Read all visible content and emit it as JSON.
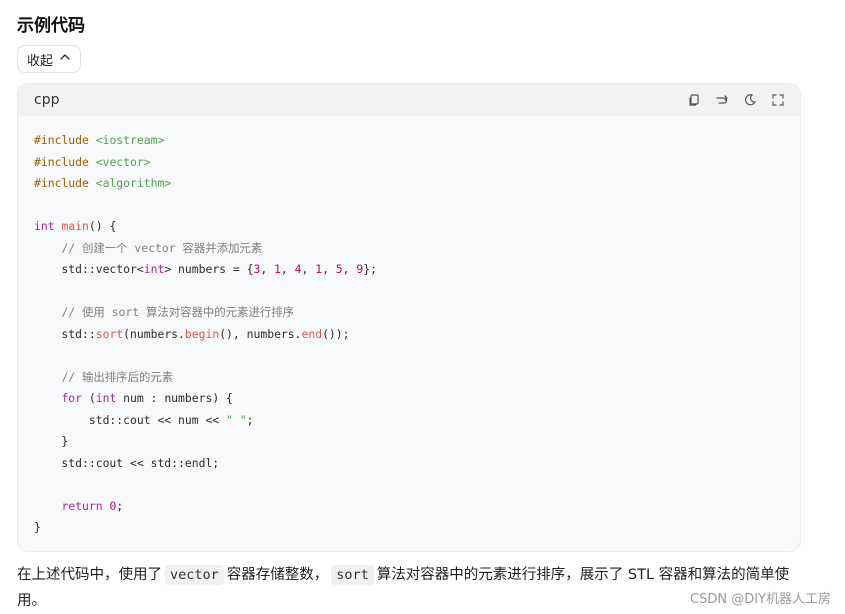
{
  "heading": "示例代码",
  "collapse_label": "收起",
  "code_block": {
    "language": "cpp",
    "lines": [
      [
        {
          "t": "#include",
          "c": "pp"
        },
        {
          "t": " "
        },
        {
          "t": "<iostream>",
          "c": "inc"
        }
      ],
      [
        {
          "t": "#include",
          "c": "pp"
        },
        {
          "t": " "
        },
        {
          "t": "<vector>",
          "c": "inc"
        }
      ],
      [
        {
          "t": "#include",
          "c": "pp"
        },
        {
          "t": " "
        },
        {
          "t": "<algorithm>",
          "c": "inc"
        }
      ],
      [],
      [
        {
          "t": "int",
          "c": "ty"
        },
        {
          "t": " "
        },
        {
          "t": "main",
          "c": "fn"
        },
        {
          "t": "() {"
        }
      ],
      [
        {
          "t": "    "
        },
        {
          "t": "// 创建一个 vector 容器并添加元素",
          "c": "cm"
        }
      ],
      [
        {
          "t": "    std::vector<"
        },
        {
          "t": "int",
          "c": "ty"
        },
        {
          "t": "> numbers = {"
        },
        {
          "t": "3",
          "c": "num"
        },
        {
          "t": ", "
        },
        {
          "t": "1",
          "c": "num"
        },
        {
          "t": ", "
        },
        {
          "t": "4",
          "c": "num"
        },
        {
          "t": ", "
        },
        {
          "t": "1",
          "c": "num"
        },
        {
          "t": ", "
        },
        {
          "t": "5",
          "c": "num"
        },
        {
          "t": ", "
        },
        {
          "t": "9",
          "c": "num"
        },
        {
          "t": "};"
        }
      ],
      [],
      [
        {
          "t": "    "
        },
        {
          "t": "// 使用 sort 算法对容器中的元素进行排序",
          "c": "cm"
        }
      ],
      [
        {
          "t": "    std::"
        },
        {
          "t": "sort",
          "c": "fn"
        },
        {
          "t": "(numbers."
        },
        {
          "t": "begin",
          "c": "fn"
        },
        {
          "t": "(), numbers."
        },
        {
          "t": "end",
          "c": "fn"
        },
        {
          "t": "());"
        }
      ],
      [],
      [
        {
          "t": "    "
        },
        {
          "t": "// 输出排序后的元素",
          "c": "cm"
        }
      ],
      [
        {
          "t": "    "
        },
        {
          "t": "for",
          "c": "kw"
        },
        {
          "t": " ("
        },
        {
          "t": "int",
          "c": "ty"
        },
        {
          "t": " num : numbers) {"
        }
      ],
      [
        {
          "t": "        std::cout << num << "
        },
        {
          "t": "\" \"",
          "c": "str"
        },
        {
          "t": ";"
        }
      ],
      [
        {
          "t": "    }"
        }
      ],
      [
        {
          "t": "    std::cout << std::endl;"
        }
      ],
      [],
      [
        {
          "t": "    "
        },
        {
          "t": "return",
          "c": "kw"
        },
        {
          "t": " "
        },
        {
          "t": "0",
          "c": "num"
        },
        {
          "t": ";"
        }
      ],
      [
        {
          "t": "}"
        }
      ]
    ]
  },
  "description": {
    "part1": "在上述代码中，使用了",
    "code1": "vector",
    "part2": "容器存储整数，",
    "code2": "sort",
    "part3": "算法对容器中的元素进行排序，展示了 STL 容器和算法的简单使用。"
  },
  "watermark": "CSDN @DIY机器人工房",
  "icons": [
    "copy-icon",
    "wrap-icon",
    "theme-icon",
    "expand-icon",
    "chevron-up-icon"
  ]
}
